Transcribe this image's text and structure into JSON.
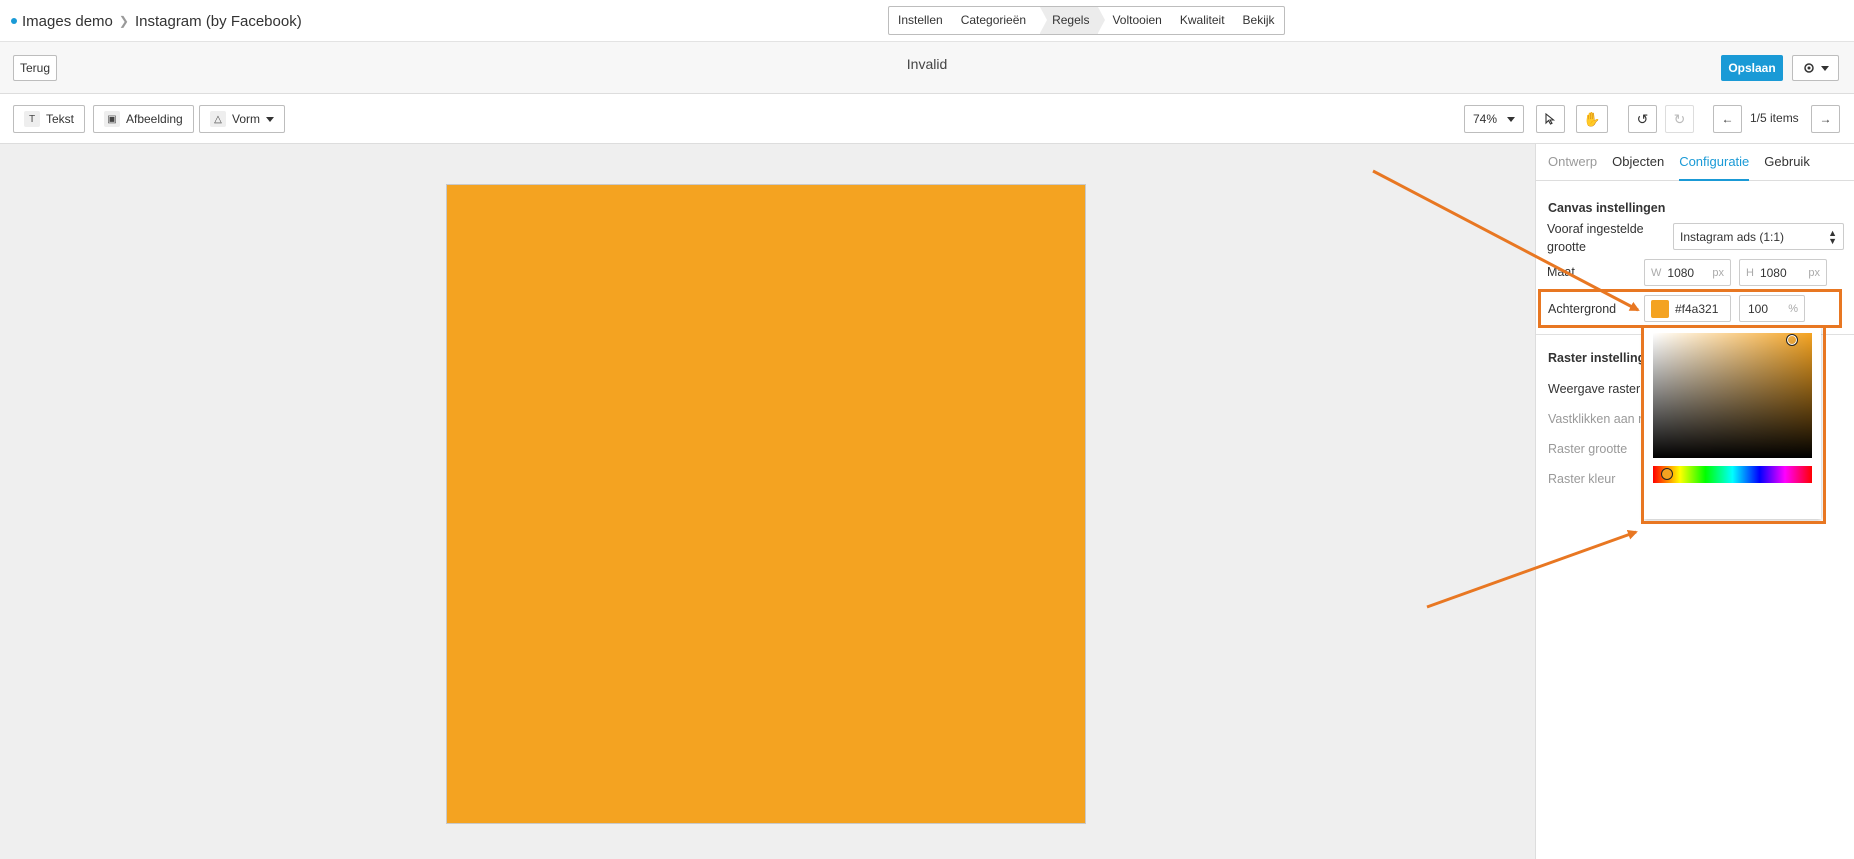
{
  "breadcrumb": {
    "project": "Images demo",
    "current": "Instagram (by Facebook)"
  },
  "steps": [
    "Instellen",
    "Categorieën",
    "Regels",
    "Voltooien",
    "Kwaliteit",
    "Bekijk"
  ],
  "header": {
    "back_label": "Terug",
    "status": "Invalid",
    "save_label": "Opslaan"
  },
  "toolbar": {
    "text_label": "Tekst",
    "image_label": "Afbeelding",
    "shape_label": "Vorm",
    "zoom": "74%",
    "items_counter": "1/5 items"
  },
  "canvas": {
    "background": "#f4a321"
  },
  "panel": {
    "tabs": [
      "Ontwerp",
      "Objecten",
      "Configuratie",
      "Gebruik"
    ],
    "canvas_section": "Canvas instellingen",
    "preset_label": "Vooraf ingestelde grootte",
    "preset_value": "Instagram ads (1:1)",
    "size_label": "Maat",
    "width_prefix": "W",
    "width_value": "1080",
    "height_prefix": "H",
    "height_value": "1080",
    "unit": "px",
    "background_label": "Achtergrond",
    "background_hex": "#f4a321",
    "opacity_value": "100",
    "opacity_unit": "%",
    "grid_section": "Raster instellingen",
    "grid_show": "Weergave raster",
    "grid_snap": "Vastklikken aan raster",
    "grid_size": "Raster grootte",
    "grid_color": "Raster kleur"
  },
  "colors": {
    "accent": "#1a9ad6",
    "annotation": "#e87722",
    "swatch": "#f4a321"
  }
}
